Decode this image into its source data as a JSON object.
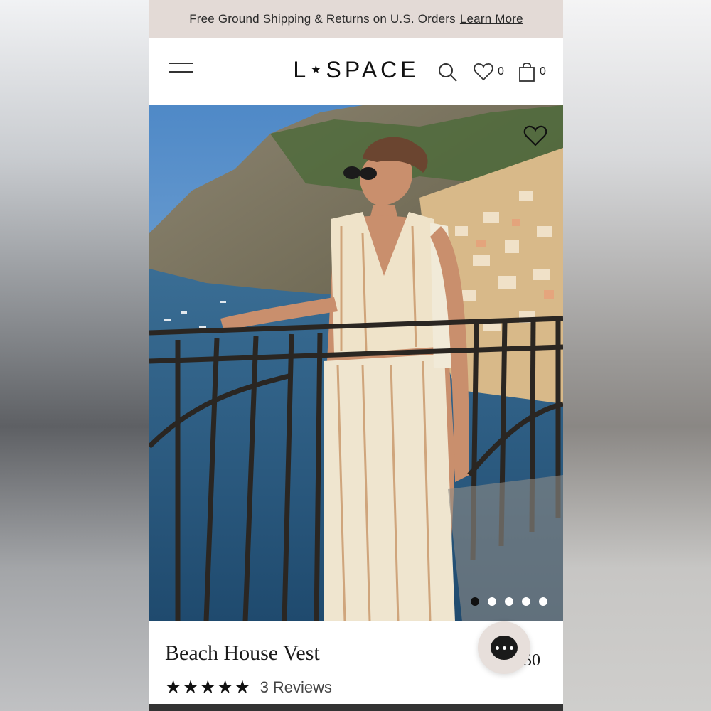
{
  "promo": {
    "text": "Free Ground Shipping & Returns on U.S. Orders",
    "link": "Learn More"
  },
  "header": {
    "logo_left": "L",
    "logo_star": "★",
    "logo_right": "SPACE",
    "wishlist_count": "0",
    "cart_count": "0",
    "icons": [
      "menu-icon",
      "search-icon",
      "heart-icon",
      "bag-icon"
    ]
  },
  "gallery": {
    "image_count": 5,
    "active_index": 0,
    "favorite_icon": "heart-outline-icon"
  },
  "product": {
    "name": "Beach House Vest",
    "price_partial": "50",
    "rating_stars": 5,
    "reviews_label": "3 Reviews"
  },
  "chat": {
    "icon": "chat-bubble-icon"
  }
}
